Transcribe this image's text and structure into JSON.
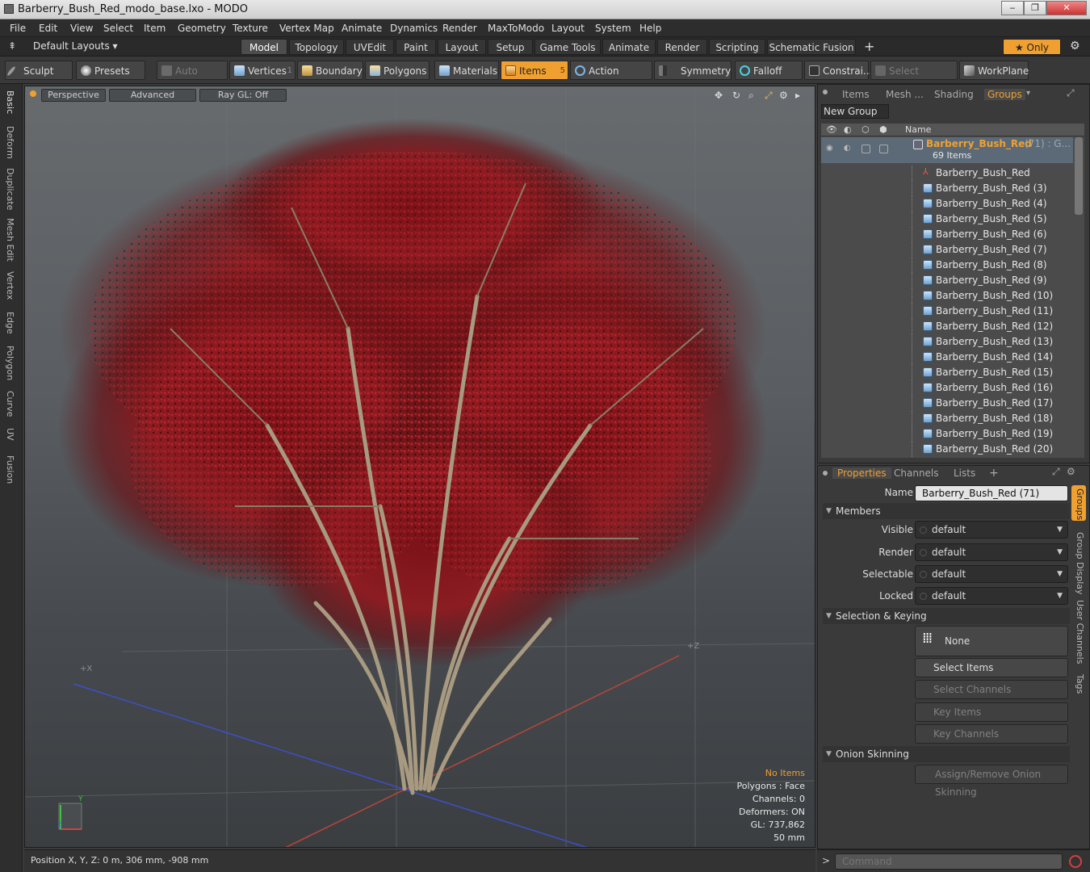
{
  "window": {
    "title": "Barberry_Bush_Red_modo_base.lxo - MODO",
    "min": "‒",
    "max": "❐",
    "close": "✕"
  },
  "menu": [
    "File",
    "Edit",
    "View",
    "Select",
    "Item",
    "Geometry",
    "Texture",
    "Vertex Map",
    "Animate",
    "Dynamics",
    "Render",
    "MaxToModo",
    "Layout",
    "System",
    "Help"
  ],
  "layout_selector": "Default Layouts ▾",
  "mode_tabs": [
    "Model",
    "Topology",
    "UVEdit",
    "Paint",
    "Layout",
    "Setup",
    "Game Tools",
    "Animate",
    "Render",
    "Scripting",
    "Schematic Fusion"
  ],
  "mode_add": "+",
  "only_label": "★ Only",
  "toolbar": {
    "sculpt": "Sculpt",
    "presets": "Presets",
    "auto_select": "Auto Select",
    "vertices": "Vertices",
    "vertices_count": "1",
    "boundary": "Boundary",
    "polygons": "Polygons",
    "materials": "Materials",
    "items": "Items",
    "items_count": "5",
    "action_center": "Action Center",
    "symmetry": "Symmetry",
    "falloff": "Falloff",
    "constraints": "Constrai...",
    "select_through": "Select Through",
    "workplane": "WorkPlane"
  },
  "left_tabs": [
    "Basic",
    "Deform",
    "Duplicate",
    "Mesh Edit",
    "Vertex",
    "Edge",
    "Polygon",
    "Curve",
    "UV",
    "Fusion"
  ],
  "viewport": {
    "perspective": "Perspective",
    "advanced": "Advanced",
    "raygl": "Ray GL: Off",
    "info": {
      "no_items": "No Items",
      "polygons": "Polygons : Face",
      "channels": "Channels: 0",
      "deformers": "Deformers: ON",
      "gl": "GL: 737,862",
      "scale": "50 mm"
    },
    "axis_y": "Y",
    "axis_x": "X",
    "axis_z": "Z",
    "grid_x": "+X",
    "grid_z": "+Z"
  },
  "status": {
    "position": "Position X, Y, Z:   0 m, 306 mm, -908 mm"
  },
  "outliner": {
    "tabs": [
      "Items",
      "Mesh ...",
      "Shading",
      "Groups"
    ],
    "new_group": "New Group",
    "col_name": "Name",
    "group_name": "Barberry_Bush_Red",
    "group_suffix": "(71) : G...",
    "group_count": "69 Items",
    "rows": [
      "Barberry_Bush_Red",
      "Barberry_Bush_Red (3)",
      "Barberry_Bush_Red (4)",
      "Barberry_Bush_Red (5)",
      "Barberry_Bush_Red (6)",
      "Barberry_Bush_Red (7)",
      "Barberry_Bush_Red (8)",
      "Barberry_Bush_Red (9)",
      "Barberry_Bush_Red (10)",
      "Barberry_Bush_Red (11)",
      "Barberry_Bush_Red (12)",
      "Barberry_Bush_Red (13)",
      "Barberry_Bush_Red (14)",
      "Barberry_Bush_Red (15)",
      "Barberry_Bush_Red (16)",
      "Barberry_Bush_Red (17)",
      "Barberry_Bush_Red (18)",
      "Barberry_Bush_Red (19)",
      "Barberry_Bush_Red (20)"
    ]
  },
  "properties": {
    "tabs": [
      "Properties",
      "Channels",
      "Lists",
      "+"
    ],
    "name_label": "Name",
    "name_value": "Barberry_Bush_Red (71)",
    "members": "Members",
    "visible": "Visible",
    "render": "Render",
    "selectable": "Selectable",
    "locked": "Locked",
    "default": "default",
    "selection_keying": "Selection & Keying",
    "none": "None",
    "select_items": "Select Items",
    "select_channels": "Select Channels",
    "key_items": "Key Items",
    "key_channels": "Key Channels",
    "onion": "Onion Skinning",
    "assign_onion": "Assign/Remove Onion Skinning",
    "side_tabs": [
      "Groups",
      "Group Display",
      "User Channels",
      "Tags"
    ]
  },
  "command": {
    "placeholder": "Command",
    "prompt": ">"
  }
}
